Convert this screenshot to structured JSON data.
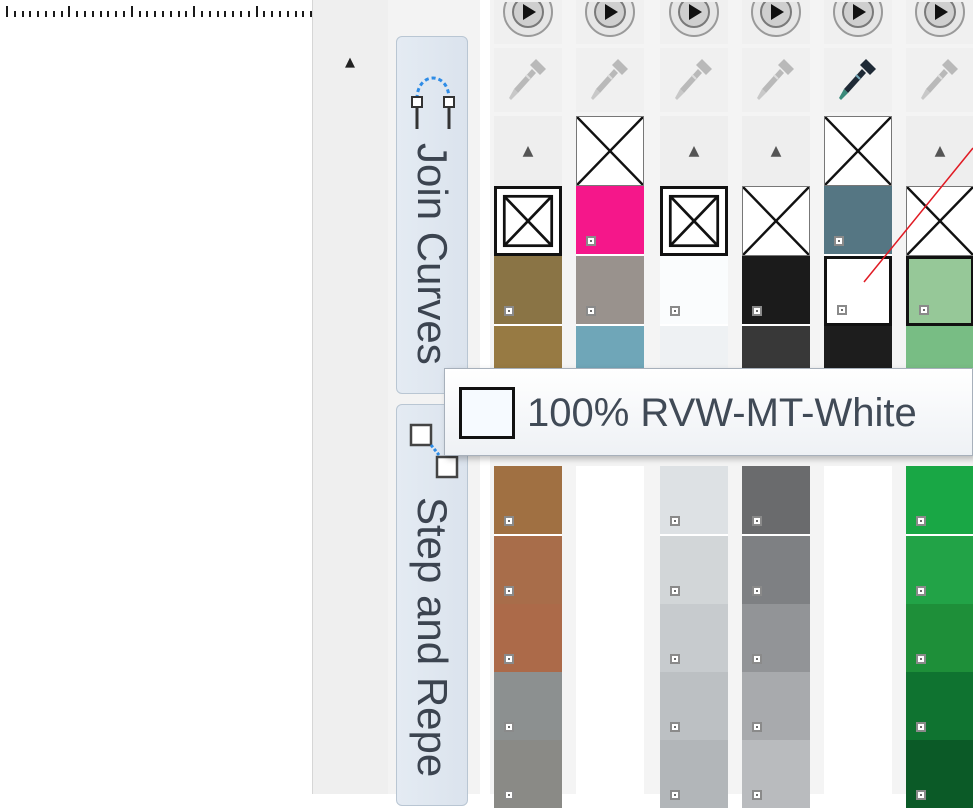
{
  "tooltip": {
    "text": "100% RVW-MT-White",
    "swatch_color": "#f6faff"
  },
  "dockers": {
    "join_curves": {
      "label": "Join Curves",
      "icon": "join-curves-icon"
    },
    "step_and_repeat": {
      "label": "Step and Repe",
      "icon": "step-and-repeat-icon"
    }
  },
  "palette": {
    "columns": [
      {
        "id": "c1",
        "header": "playbtn",
        "dropper": "gray",
        "cells": [
          "arrow",
          "nocolor-bold",
          "#8a7445",
          "#977a43",
          "hidden",
          "#a07042",
          "#a86d4a",
          "#ac6a49",
          "#8c9090",
          "#8a8a86"
        ]
      },
      {
        "id": "c2",
        "header": "playbtn",
        "dropper": "gray",
        "cells": [
          "nocolor",
          "#f5178a",
          "#99928d",
          "#6fa6b8",
          "hidden",
          "#ffffff",
          "#ffffff",
          "#ffffff",
          "#ffffff",
          "#ffffff"
        ]
      },
      {
        "id": "c3",
        "header": "playbtn",
        "dropper": "gray",
        "cells": [
          "arrow",
          "nocolor-bold",
          "#fafcfd",
          "#eef1f3",
          "hidden",
          "#dde1e4",
          "#d2d6d8",
          "#c7cbce",
          "#bcc0c3",
          "#b2b6b9"
        ]
      },
      {
        "id": "c4",
        "header": "playbtn",
        "dropper": "gray",
        "cells": [
          "arrow",
          "nocolor",
          "#1b1b1b",
          "#383838",
          "hidden",
          "#6a6b6d",
          "#7e8083",
          "#929497",
          "#a8aaad",
          "#b9bbbe"
        ]
      },
      {
        "id": "c5",
        "header": "playbtn",
        "dropper": "active",
        "cells": [
          "nocolor",
          "#557683",
          "#ffffff",
          "#1d1d1d",
          "hidden",
          "#ffffff",
          "#ffffff",
          "#ffffff",
          "#ffffff",
          "#ffffff"
        ]
      },
      {
        "id": "c6",
        "header": "playbtn",
        "dropper": "gray",
        "cells": [
          "arrow",
          "nocolor",
          "#96c898",
          "#78bd84",
          "hidden",
          "#19a745",
          "#22a347",
          "#1e8f39",
          "#0f7330",
          "#0b5a27"
        ]
      }
    ]
  },
  "colors": {
    "selection_border": "#111111",
    "pointer_line": "#e01b24",
    "tab_text": "#3c4450"
  }
}
